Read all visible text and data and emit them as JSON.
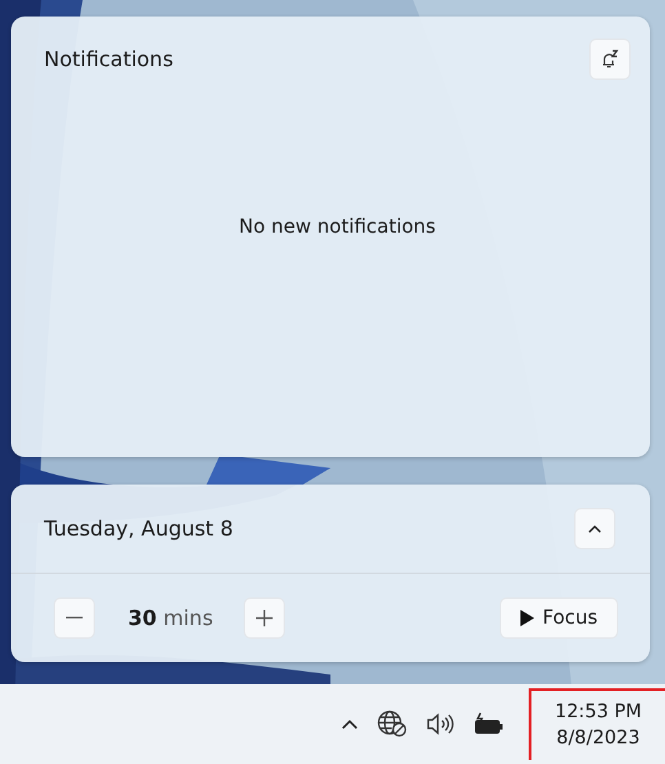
{
  "notifications": {
    "title": "Notifications",
    "empty_text": "No new notifications"
  },
  "calendar": {
    "date": "Tuesday, August 8",
    "expanded": true
  },
  "focus": {
    "duration": "30",
    "unit": "mins",
    "button": "Focus"
  },
  "taskbar": {
    "time": "12:53 PM",
    "date": "8/8/2023",
    "highlighted": true
  }
}
